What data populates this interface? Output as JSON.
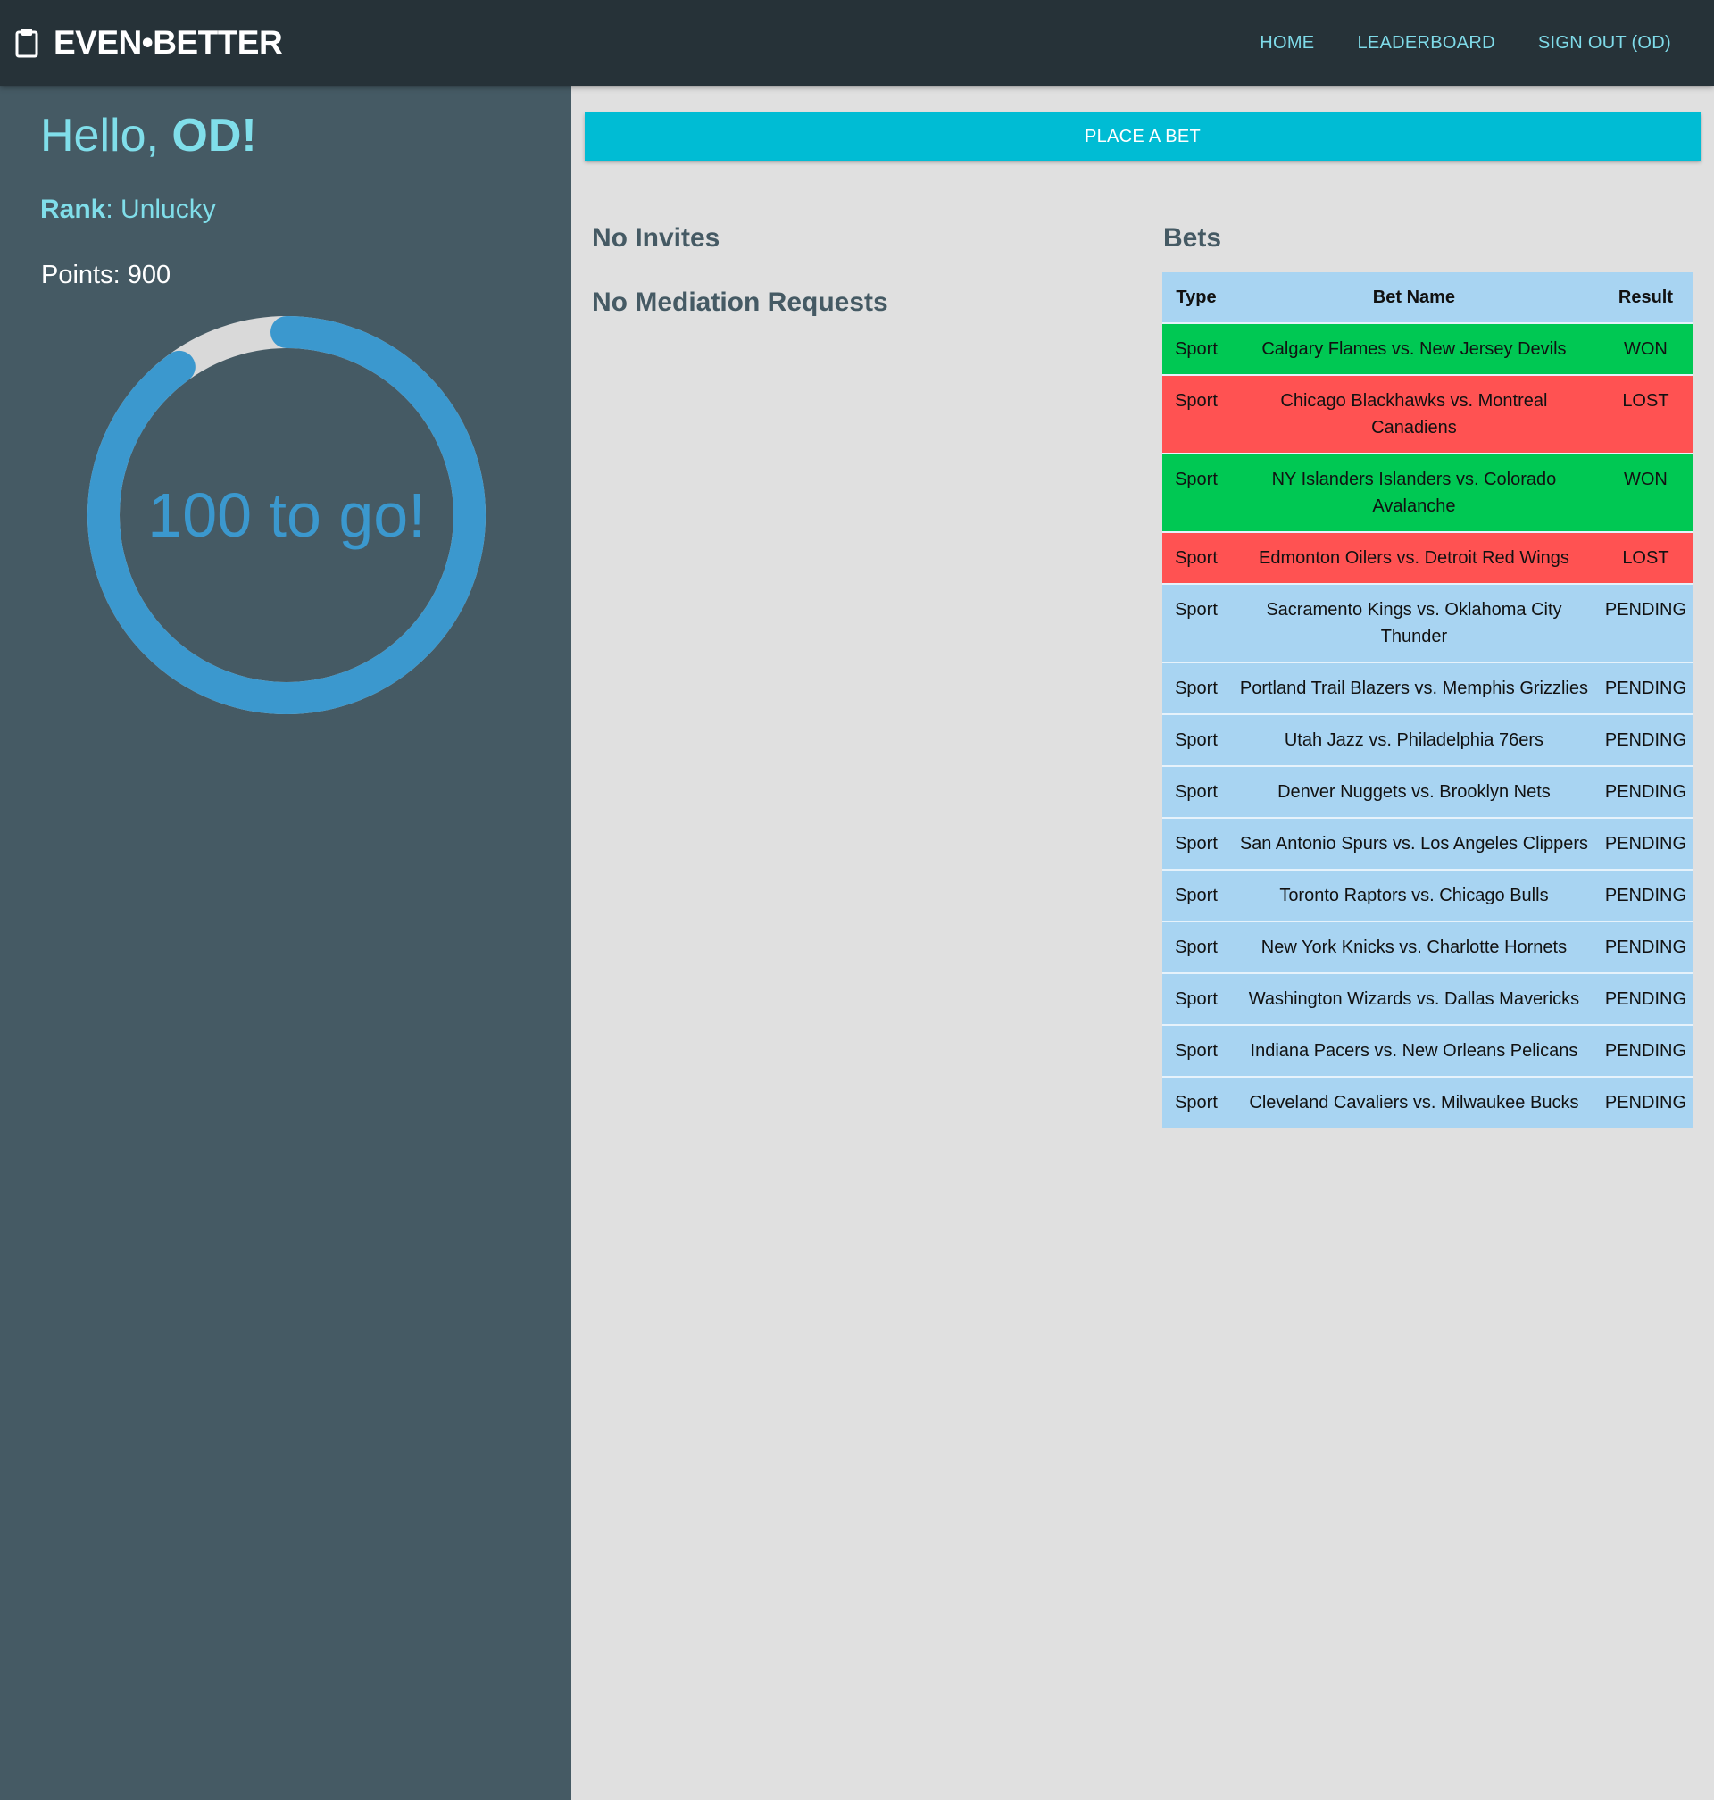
{
  "header": {
    "brand": "EVEN•BETTER",
    "nav": [
      "HOME",
      "LEADERBOARD",
      "SIGN OUT (OD)"
    ]
  },
  "profile": {
    "greeting": "Hello, ",
    "name": "OD!",
    "rank_label": "Rank",
    "rank_sep": ": ",
    "rank_value": "Unlucky",
    "points_text": "Points: 900",
    "gauge_text": "100 to go!",
    "progress_fraction": 0.9
  },
  "main": {
    "place_bet_label": "PLACE A BET",
    "invites_heading": "No Invites",
    "mediation_heading": "No Mediation Requests",
    "bets_heading": "Bets"
  },
  "bets_table": {
    "columns": [
      "Type",
      "Bet Name",
      "Result"
    ],
    "rows": [
      {
        "type": "Sport",
        "name": "Calgary Flames vs. New Jersey Devils",
        "result": "WON"
      },
      {
        "type": "Sport",
        "name": "Chicago Blackhawks vs. Montreal Canadiens",
        "result": "LOST"
      },
      {
        "type": "Sport",
        "name": "NY Islanders Islanders vs. Colorado Avalanche",
        "result": "WON"
      },
      {
        "type": "Sport",
        "name": "Edmonton Oilers vs. Detroit Red Wings",
        "result": "LOST"
      },
      {
        "type": "Sport",
        "name": "Sacramento Kings vs. Oklahoma City Thunder",
        "result": "PENDING"
      },
      {
        "type": "Sport",
        "name": "Portland Trail Blazers vs. Memphis Grizzlies",
        "result": "PENDING"
      },
      {
        "type": "Sport",
        "name": "Utah Jazz vs. Philadelphia 76ers",
        "result": "PENDING"
      },
      {
        "type": "Sport",
        "name": "Denver Nuggets vs. Brooklyn Nets",
        "result": "PENDING"
      },
      {
        "type": "Sport",
        "name": "San Antonio Spurs vs. Los Angeles Clippers",
        "result": "PENDING"
      },
      {
        "type": "Sport",
        "name": "Toronto Raptors vs. Chicago Bulls",
        "result": "PENDING"
      },
      {
        "type": "Sport",
        "name": "New York Knicks vs. Charlotte Hornets",
        "result": "PENDING"
      },
      {
        "type": "Sport",
        "name": "Washington Wizards vs. Dallas Mavericks",
        "result": "PENDING"
      },
      {
        "type": "Sport",
        "name": "Indiana Pacers vs. New Orleans Pelicans",
        "result": "PENDING"
      },
      {
        "type": "Sport",
        "name": "Cleveland Cavaliers vs. Milwaukee Bucks",
        "result": "PENDING"
      }
    ]
  },
  "colors": {
    "topbar": "#263238",
    "sidebar": "#455a64",
    "accent": "#00bcd4",
    "won": "#00c853",
    "lost": "#ff5252",
    "pending": "#a8d4f2",
    "gauge": "#3b98ce",
    "gauge_track": "#d9d9d9"
  },
  "icons": {
    "brand_icon": "clipboard-icon"
  }
}
